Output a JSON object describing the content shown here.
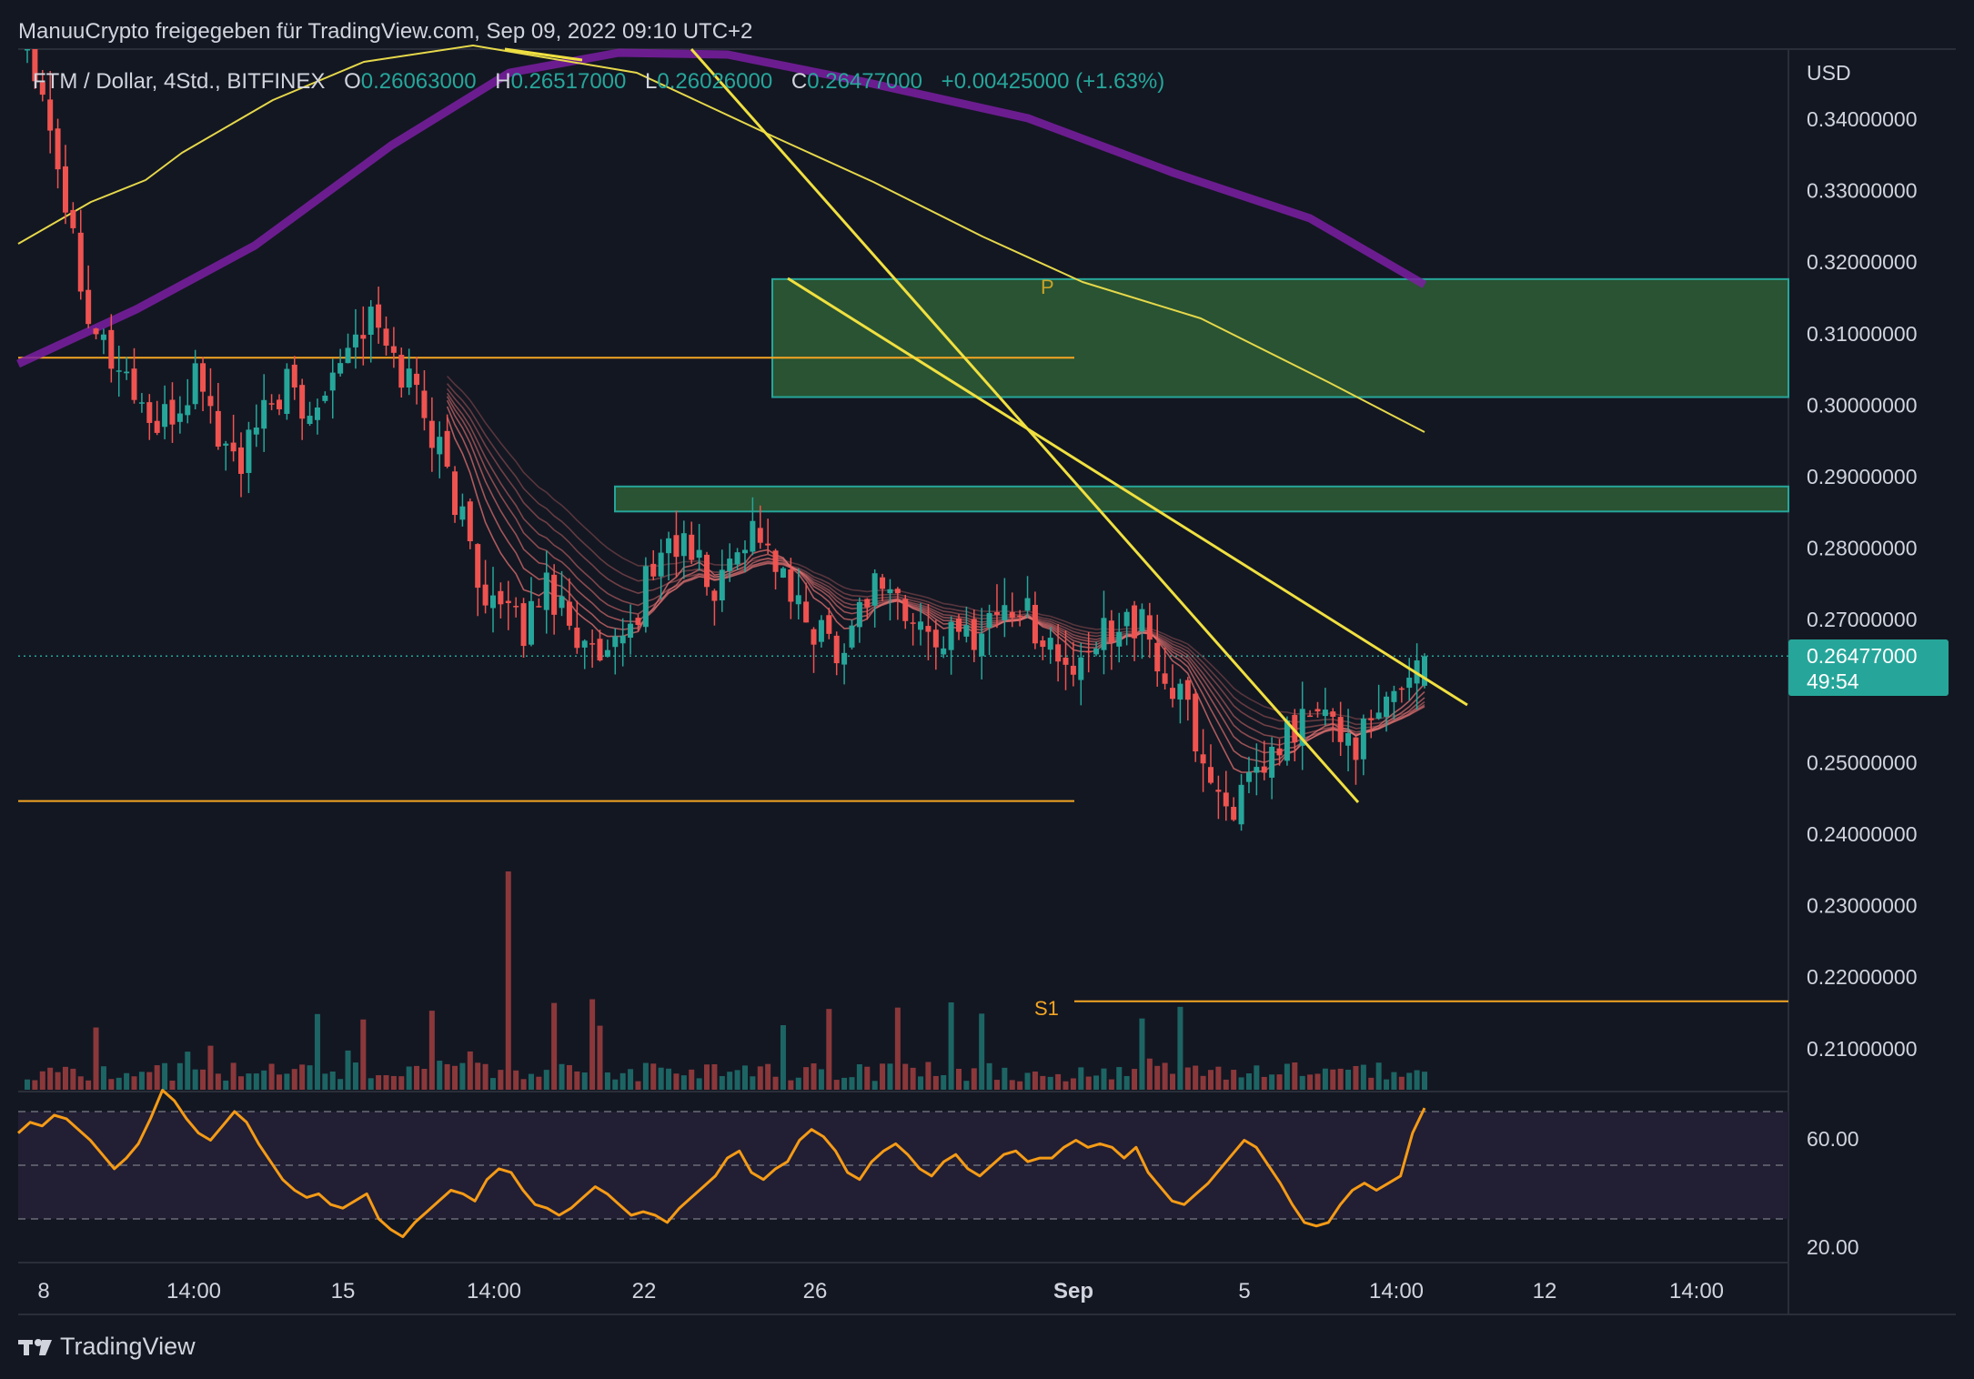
{
  "header": {
    "attribution": "ManuuCrypto freigegeben für TradingView.com, Sep 09, 2022 09:10 UTC+2"
  },
  "legend": {
    "symbol": "FTM / Dollar, 4Std., BITFINEX",
    "o_label": "O",
    "o_value": "0.26063000",
    "h_label": "H",
    "h_value": "0.26517000",
    "l_label": "L",
    "l_value": "0.26026000",
    "c_label": "C",
    "c_value": "0.26477000",
    "change": "+0.00425000 (+1.63%)"
  },
  "price_axis": {
    "currency": "USD",
    "ticks": [
      "0.34000000",
      "0.33000000",
      "0.32000000",
      "0.31000000",
      "0.30000000",
      "0.29000000",
      "0.28000000",
      "0.27000000",
      "0.25000000",
      "0.24000000",
      "0.23000000",
      "0.22000000",
      "0.21000000"
    ],
    "last_price": "0.26477000",
    "countdown": "49:54"
  },
  "rsi_axis": {
    "ticks": [
      "60.00",
      "20.00"
    ]
  },
  "time_axis": {
    "ticks": [
      "8",
      "14:00",
      "15",
      "14:00",
      "22",
      "26",
      "Sep",
      "5",
      "14:00",
      "12",
      "14:00"
    ]
  },
  "annotations": {
    "pivot": "P",
    "support": "S1"
  },
  "footer": {
    "brand": "TradingView"
  },
  "colors": {
    "background": "#131722",
    "up": "#26a69a",
    "down": "#ef5350",
    "trendline": "#f0e040",
    "sma_purple": "#7b1fa2",
    "sma_yellow": "#e6d84a",
    "zone_fill": "#2e5e35",
    "zone_border": "#26a69a",
    "level_orange": "#f5a623",
    "rsi_line": "#f59b16",
    "rsi_band": "#221e33",
    "ribbon": "#e57373"
  },
  "chart_data": [
    {
      "type": "candlestick",
      "title": "FTM / Dollar, 4Std., BITFINEX",
      "ylabel": "USD",
      "ylim": [
        0.204,
        0.35
      ],
      "x": [
        "8",
        "14:00",
        "15",
        "14:00",
        "22",
        "26",
        "Sep",
        "5",
        "14:00",
        "12",
        "14:00"
      ],
      "close_path": [
        0.352,
        0.341,
        0.325,
        0.312,
        0.306,
        0.302,
        0.296,
        0.299,
        0.305,
        0.294,
        0.292,
        0.298,
        0.303,
        0.297,
        0.305,
        0.309,
        0.312,
        0.306,
        0.303,
        0.295,
        0.286,
        0.276,
        0.271,
        0.268,
        0.275,
        0.272,
        0.265,
        0.263,
        0.268,
        0.277,
        0.281,
        0.279,
        0.273,
        0.281,
        0.283,
        0.276,
        0.27,
        0.268,
        0.266,
        0.274,
        0.276,
        0.269,
        0.268,
        0.267,
        0.268,
        0.271,
        0.272,
        0.269,
        0.264,
        0.262,
        0.268,
        0.271,
        0.268,
        0.261,
        0.257,
        0.247,
        0.244,
        0.246,
        0.251,
        0.255,
        0.257,
        0.254,
        0.253,
        0.256,
        0.262,
        0.2648
      ],
      "last": {
        "open": 0.26063,
        "high": 0.26517,
        "low": 0.26026,
        "close": 0.26477
      },
      "zones": [
        [
          0.301,
          0.3175
        ],
        [
          0.285,
          0.2885
        ]
      ],
      "levels": {
        "upper": 0.3065,
        "lower": 0.2445,
        "S1": 0.2165
      }
    },
    {
      "type": "line",
      "title": "RSI",
      "ylim": [
        10,
        70
      ],
      "band": [
        30,
        60
      ],
      "values": [
        54,
        57,
        56,
        59,
        58,
        55,
        52,
        48,
        44,
        47,
        51,
        58,
        66,
        63,
        58,
        54,
        52,
        56,
        60,
        57,
        51,
        46,
        41,
        38,
        36,
        37,
        34,
        33,
        35,
        37,
        30,
        27,
        25,
        29,
        32,
        35,
        38,
        37,
        35,
        41,
        44,
        43,
        38,
        34,
        33,
        31,
        33,
        36,
        39,
        37,
        34,
        31,
        32,
        31,
        29,
        33,
        36,
        39,
        42,
        47,
        49,
        43,
        41,
        44,
        46,
        52,
        55,
        53,
        49,
        43,
        41,
        46,
        49,
        51,
        48,
        44,
        42,
        46,
        48,
        44,
        42,
        45,
        48,
        49,
        46,
        47,
        47,
        50,
        52,
        50,
        51,
        50,
        47,
        50,
        43,
        39,
        35,
        34,
        37,
        40,
        44,
        48,
        52,
        50,
        45,
        40,
        34,
        29,
        28,
        29,
        34,
        38,
        40,
        38,
        40,
        42,
        54,
        61
      ]
    }
  ]
}
